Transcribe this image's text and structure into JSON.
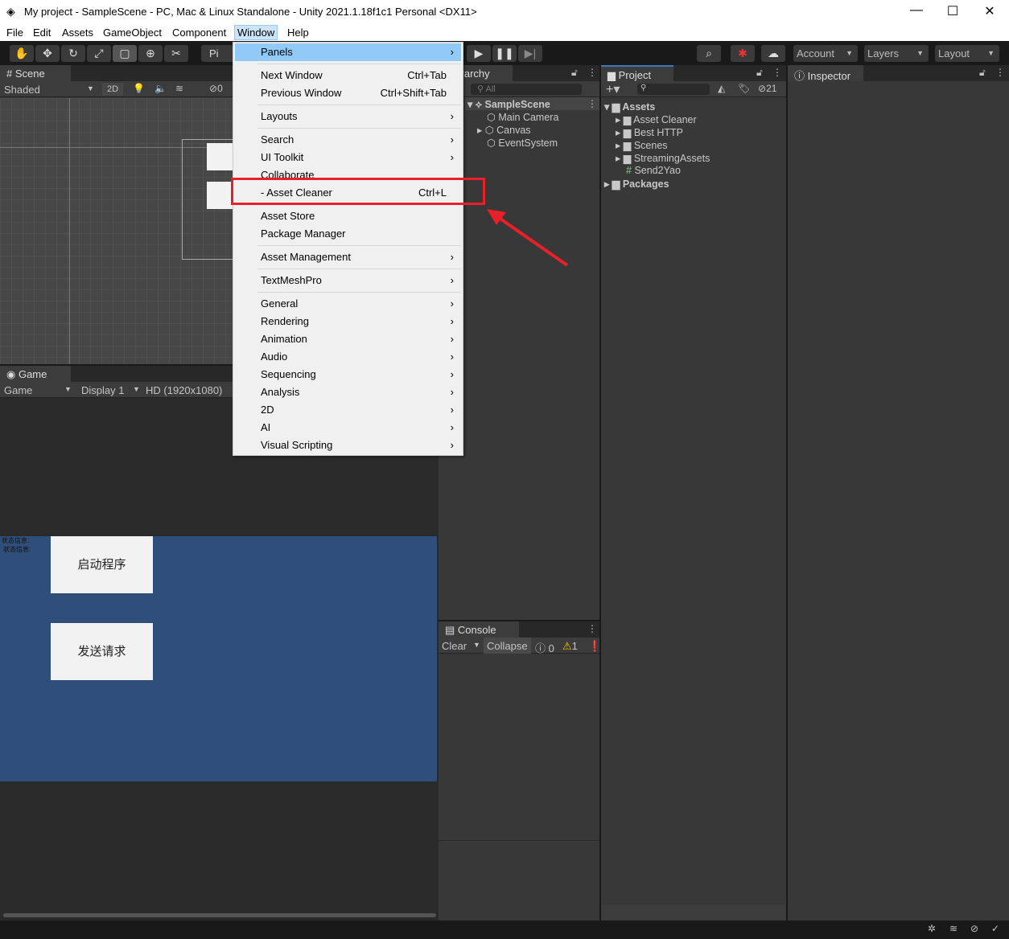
{
  "title": "My project - SampleScene - PC, Mac & Linux Standalone - Unity 2021.1.18f1c1 Personal <DX11>",
  "menubar": [
    "File",
    "Edit",
    "Assets",
    "GameObject",
    "Component",
    "Window",
    "Help"
  ],
  "toolbar": {
    "pivot": "Pi",
    "account": "Account",
    "layers": "Layers",
    "layout": "Layout"
  },
  "scene": {
    "tab": "Scene",
    "shading": "Shaded",
    "mode2d": "2D",
    "hidden_count": "0"
  },
  "game": {
    "tab": "Game",
    "view": "Game",
    "display": "Display 1",
    "resolution": "HD (1920x1080)",
    "status_lines": [
      "状态信息:",
      "状态信息:"
    ],
    "buttons": [
      "启动程序",
      "发送请求"
    ]
  },
  "hierarchy": {
    "tab": "Hierarchy",
    "search": "All",
    "scene": "SampleScene",
    "items": [
      "Main Camera",
      "Canvas",
      "EventSystem"
    ]
  },
  "project": {
    "tab": "Project",
    "hidden_count": "21",
    "assets": "Assets",
    "folders": [
      "Asset Cleaner",
      "Best HTTP",
      "Scenes",
      "StreamingAssets",
      "Send2Yao"
    ],
    "packages": "Packages"
  },
  "inspector": {
    "tab": "Inspector"
  },
  "console": {
    "tab": "Console",
    "clear": "Clear",
    "collapse": "Collapse",
    "logs": "0",
    "warnings": "1"
  },
  "window_menu": [
    {
      "label": "Panels",
      "arrow": true,
      "highlight": true
    },
    {
      "label": "Next Window",
      "shortcut": "Ctrl+Tab",
      "sep": true
    },
    {
      "label": "Previous Window",
      "shortcut": "Ctrl+Shift+Tab"
    },
    {
      "label": "Layouts",
      "arrow": true,
      "sep": true
    },
    {
      "label": "Search",
      "arrow": true,
      "sep": true
    },
    {
      "label": "UI Toolkit",
      "arrow": true
    },
    {
      "label": "Collaborate"
    },
    {
      "label": "- Asset Cleaner",
      "shortcut": "Ctrl+L"
    },
    {
      "label": "Asset Store",
      "sep": true
    },
    {
      "label": "Package Manager"
    },
    {
      "label": "Asset Management",
      "arrow": true,
      "sep": true
    },
    {
      "label": "TextMeshPro",
      "arrow": true,
      "sep": true
    },
    {
      "label": "General",
      "arrow": true,
      "sep": true
    },
    {
      "label": "Rendering",
      "arrow": true
    },
    {
      "label": "Animation",
      "arrow": true
    },
    {
      "label": "Audio",
      "arrow": true
    },
    {
      "label": "Sequencing",
      "arrow": true
    },
    {
      "label": "Analysis",
      "arrow": true
    },
    {
      "label": "2D",
      "arrow": true
    },
    {
      "label": "AI",
      "arrow": true
    },
    {
      "label": "Visual Scripting",
      "arrow": true
    }
  ],
  "colors": {
    "highlight": "#91c9f7",
    "annotation": "#e8202a",
    "game_bg": "#2f4f7a"
  }
}
